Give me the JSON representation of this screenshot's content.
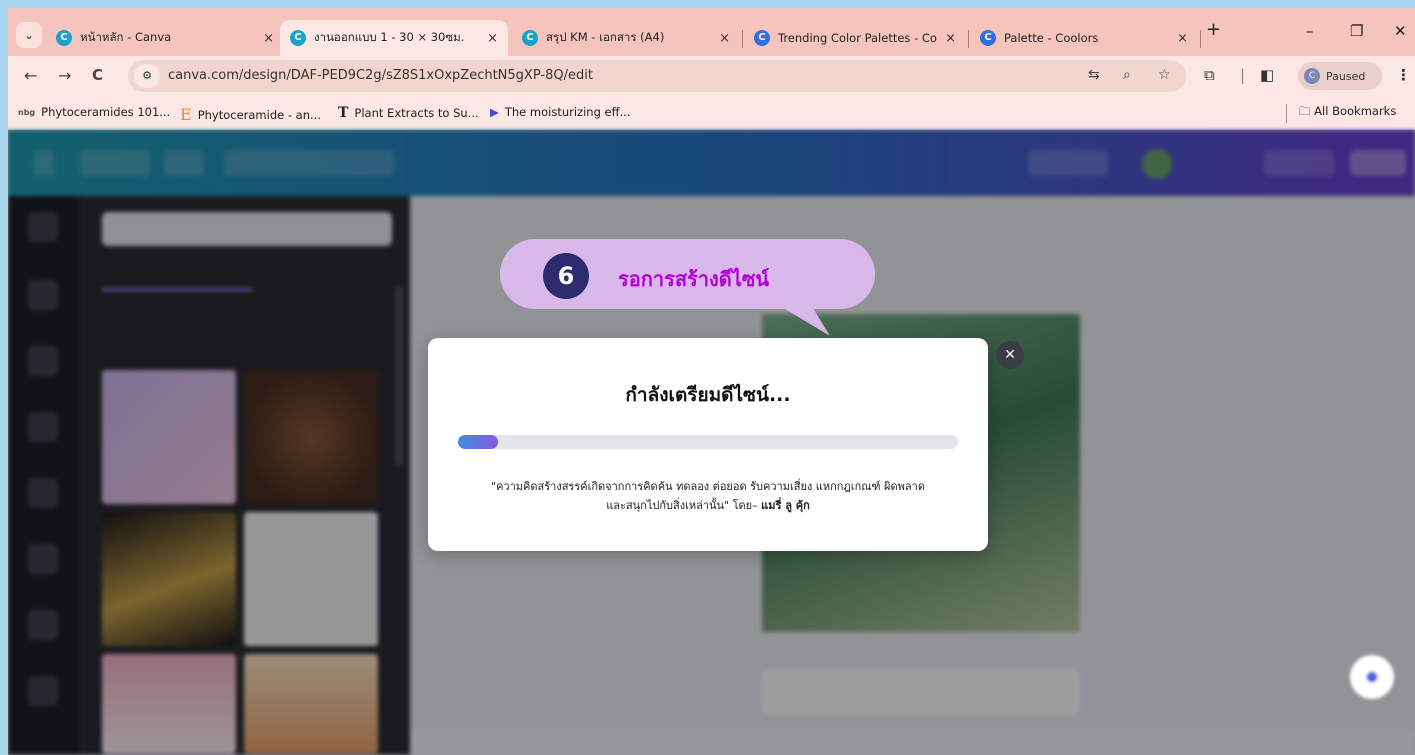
{
  "browser": {
    "tabs": [
      {
        "title": "หน้าหลัก - Canva",
        "fav_color": "#1aa3c9",
        "fav": "C"
      },
      {
        "title": "งานออกแบบ 1 - 30 × 30ซม.",
        "fav_color": "#1aa3c9",
        "fav": "C"
      },
      {
        "title": "สรุป KM - เอกสาร (A4)",
        "fav_color": "#1aa3c9",
        "fav": "C"
      },
      {
        "title": "Trending Color Palettes - Co",
        "fav_color": "#2f6fe0",
        "fav": "C"
      },
      {
        "title": "Palette - Coolors",
        "fav_color": "#2f6fe0",
        "fav": "C"
      }
    ],
    "active_tab": 1,
    "new_tab": "+",
    "close_glyph": "×",
    "url": "canva.com/design/DAF-PED9C2g/sZ8S1xOxpZechtN5gXP-8Q/edit",
    "profile_label": "Paused",
    "profile_initial": "C",
    "bookmarks": [
      {
        "label": "Phytoceramides 101...",
        "icon": "nbg"
      },
      {
        "label": "Phytoceramide - an...",
        "icon": "E"
      },
      {
        "label": "Plant Extracts to Su...",
        "icon": "T"
      },
      {
        "label": "The moisturizing eff...",
        "icon": "▶"
      }
    ],
    "all_bookmarks": "All Bookmarks"
  },
  "callout": {
    "number": "6",
    "text": "รอการสร้างดีไซน์",
    "bg_color": "#d7b8e8",
    "text_color": "#b300d6"
  },
  "modal": {
    "title": "กำลังเตรียมดีไซน์...",
    "progress": 0.08,
    "quote_line1": "\"ความคิดสร้างสรรค์เกิดจากการคิดค้น ทดลอง ต่อยอด รับความเสี่ยง แหกกฎเกณฑ์ ผิดพลาด",
    "quote_line2": "และสนุกไปกับสิ่งเหล่านั้น\" โดย–",
    "quote_author": "แมรี่ ลู คุ้ก"
  }
}
